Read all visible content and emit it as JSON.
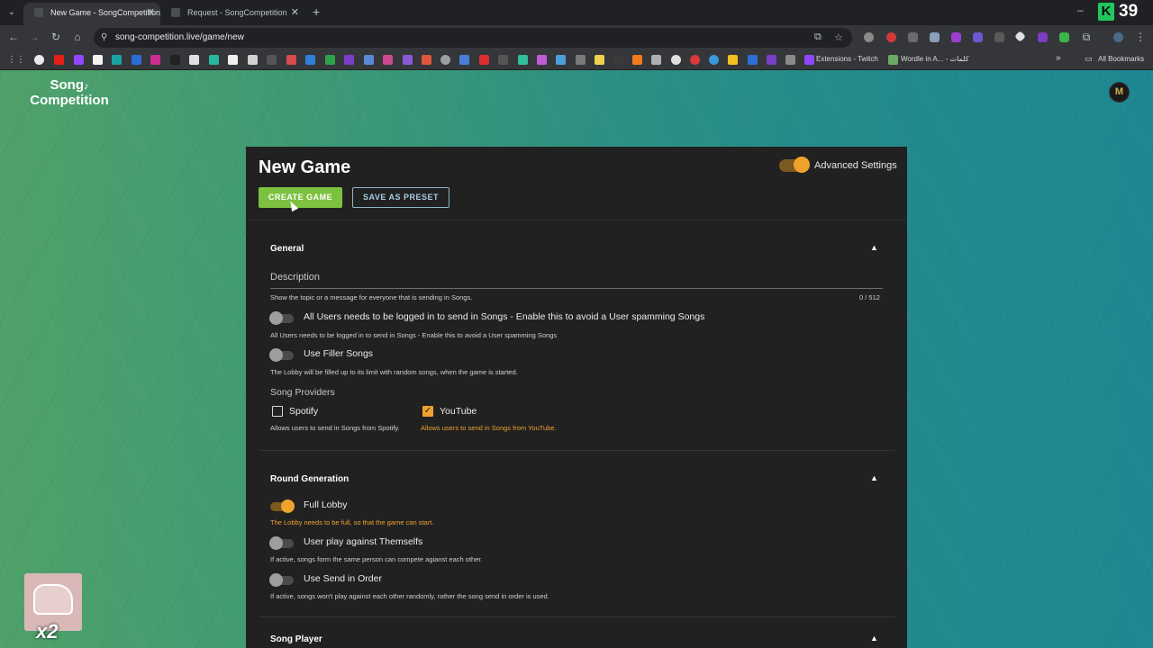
{
  "browser": {
    "tabs": [
      {
        "title": "New Game - SongCompetition",
        "active": true
      },
      {
        "title": "Request - SongCompetition",
        "active": false
      }
    ],
    "url": "song-competition.live/game/new",
    "counter": "39",
    "counter_badge": "K",
    "bookmarks": [
      {
        "label": "Extensions - Twitch"
      },
      {
        "label": "Wordle in A... - كلمات"
      }
    ],
    "all_bookmarks": "All Bookmarks"
  },
  "header": {
    "logo_line1": "Song",
    "logo_note": "♪",
    "logo_line2": "Competition",
    "profile_initials": "M"
  },
  "form": {
    "title": "New Game",
    "create_button": "CREATE GAME",
    "preset_button": "SAVE AS PRESET",
    "advanced_settings": {
      "label": "Advanced Settings",
      "enabled": true
    },
    "general": {
      "title": "General",
      "description_label": "Description",
      "description_hint": "Show the topic or a message for everyone that is sending in Songs.",
      "description_counter": "0 / 512",
      "login_required": {
        "label": "All Users needs to be logged in to send in Songs - Enable this to avoid a User spamming Songs",
        "hint": "All Users needs to be logged in to send in Songs - Enable this to avoid a User spamming Songs",
        "enabled": false
      },
      "filler_songs": {
        "label": "Use Filler Songs",
        "hint": "The Lobby will be filled up to its limit with random songs, when the game is started.",
        "enabled": false
      },
      "providers_label": "Song Providers",
      "providers": [
        {
          "name": "Spotify",
          "checked": false,
          "hint": "Allows users to send in Songs from Spotify."
        },
        {
          "name": "YouTube",
          "checked": true,
          "hint": "Allows users to send in Songs from YouTube."
        }
      ]
    },
    "round_generation": {
      "title": "Round Generation",
      "full_lobby": {
        "label": "Full Lobby",
        "hint": "The Lobby needs to be full, so that the game can start.",
        "enabled": true
      },
      "self_play": {
        "label": "User play against Themselfs",
        "hint": "If active, songs form the same person can compete agianst each other.",
        "enabled": false
      },
      "send_order": {
        "label": "Use Send in Order",
        "hint": "If active, songs won't play against each other randomly, rather the song send in order is used.",
        "enabled": false
      }
    },
    "song_player": {
      "title": "Song Player"
    }
  },
  "overlay": {
    "multiplier": "x2"
  }
}
